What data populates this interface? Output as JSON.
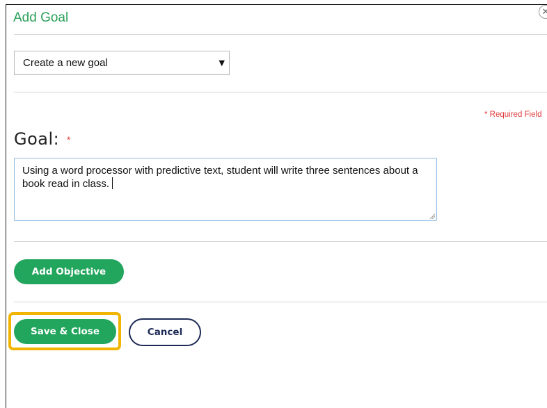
{
  "dialog": {
    "title": "Add Goal",
    "close_symbol": "✕"
  },
  "goal_select": {
    "selected": "Create a new goal",
    "caret": "▼",
    "options": [
      "Create a new goal"
    ]
  },
  "form": {
    "required_note": "* Required Field",
    "goal_label": "Goal:",
    "required_star": "*",
    "goal_text": "Using a word processor with predictive text, student will write three sentences about a book read in class."
  },
  "buttons": {
    "add_objective": "Add Objective",
    "save_close": "Save & Close",
    "cancel": "Cancel"
  },
  "colors": {
    "title_green": "#2aa05a",
    "button_green": "#22a55c",
    "required_red": "#e0393b",
    "cancel_navy": "#1d2a55",
    "highlight_yellow": "#f1b400"
  },
  "icons": {
    "close": "close-icon",
    "dropdown": "chevron-down-icon",
    "resize": "resize-grip-icon"
  }
}
